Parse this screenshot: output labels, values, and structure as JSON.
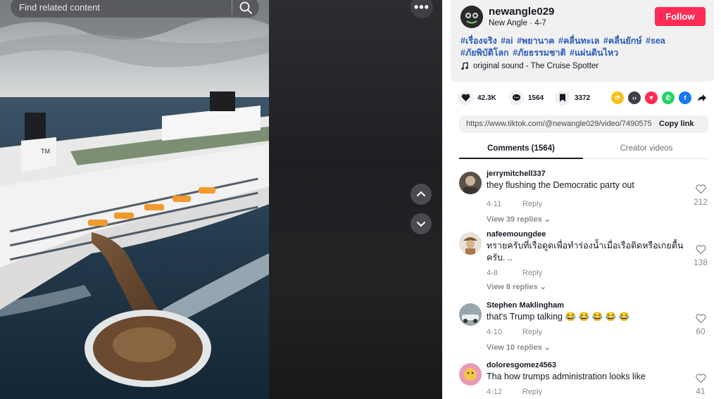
{
  "search": {
    "placeholder": "Find related content"
  },
  "video_controls": {
    "more_label": "•••"
  },
  "author": {
    "username": "newangle029",
    "nickname": "New Angle · 4-7",
    "follow_label": "Follow"
  },
  "description": {
    "hashtags": [
      "#เรื่องจริง",
      "#ai",
      "#พยานาค",
      "#คลื่นทะเล",
      "#คลื่นยักษ์",
      "#sea",
      "#ภัยพิบัติโลก",
      "#ภัยธรรมชาติ",
      "#แผ่นดินไหว"
    ],
    "music": "original sound - The Cruise Spotter"
  },
  "stats": {
    "likes": "42.3K",
    "comments": "1564",
    "saves": "3372"
  },
  "share": {
    "url": "https://www.tiktok.com/@newangle029/video/7490575",
    "copy_label": "Copy link",
    "icons": [
      {
        "name": "repost-icon",
        "color": "#f7c21e"
      },
      {
        "name": "embed-icon",
        "color": "#3f4047"
      },
      {
        "name": "send-icon",
        "color": "#fe2c55"
      },
      {
        "name": "whatsapp-icon",
        "color": "#25d366"
      },
      {
        "name": "facebook-icon",
        "color": "#1877f2"
      },
      {
        "name": "share-arrow-icon",
        "color": "#161823"
      }
    ]
  },
  "tabs": {
    "comments": "Comments (1564)",
    "creator": "Creator videos"
  },
  "comments": [
    {
      "user": "jerrymitchell337",
      "text": "they flushing the Democratic party out",
      "date": "4-11",
      "reply": "Reply",
      "replies": "View 39 replies",
      "likes": "212"
    },
    {
      "user": "nafeemoungdee",
      "text": "ทรายครับที่เรือดูดเพื่อทำร่องน้ำเมื่อเรือติดหรือเกยตื้นครับ. ..",
      "date": "4-8",
      "reply": "Reply",
      "replies": "View 8 replies",
      "likes": "138"
    },
    {
      "user": "Stephen Maklingham",
      "text": "that's Trump talking 😂 😂 😂 😂 😂",
      "date": "4-10",
      "reply": "Reply",
      "replies": "View 10 replies",
      "likes": "60"
    },
    {
      "user": "doloresgomez4563",
      "text": "Tha how trumps administration looks like",
      "date": "4-12",
      "reply": "Reply",
      "replies": "",
      "likes": "41"
    }
  ],
  "colors": {
    "accent": "#fe2c55",
    "hashtag": "#2b5db9"
  }
}
